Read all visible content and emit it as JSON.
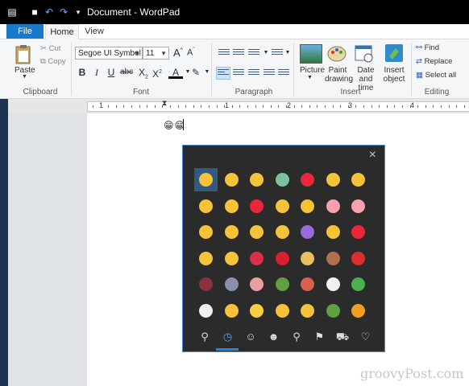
{
  "window": {
    "title": "Document - WordPad"
  },
  "tabs": {
    "file": "File",
    "home": "Home",
    "view": "View"
  },
  "clipboard": {
    "paste": "Paste",
    "cut": "Cut",
    "copy": "Copy",
    "group": "Clipboard"
  },
  "font": {
    "name": "Segoe UI Symbol",
    "size": "11",
    "group": "Font"
  },
  "paragraph": {
    "group": "Paragraph"
  },
  "insert": {
    "picture": "Picture",
    "paint_line1": "Paint",
    "paint_line2": "drawing",
    "date_line1": "Date and",
    "date_line2": "time",
    "object_line1": "Insert",
    "object_line2": "object",
    "group": "Insert"
  },
  "editing": {
    "find": "Find",
    "replace": "Replace",
    "select_all": "Select all",
    "group": "Editing"
  },
  "ruler": {
    "numbers": [
      "1",
      "1",
      "2",
      "3",
      "4"
    ]
  },
  "document": {
    "text": "😁😁"
  },
  "emoji_panel": {
    "rows": [
      [
        "#f6c23a",
        "#f6c23a",
        "#f6c23a",
        "#7cc2a0",
        "#e8273a",
        "#f6c23a",
        "#f6c23a"
      ],
      [
        "#f6c23a",
        "#f6c23a",
        "#e8273a",
        "#f6c23a",
        "#f6c23a",
        "#f6a0b0",
        "#f6a0b0"
      ],
      [
        "#f6c23a",
        "#f6c23a",
        "#f6c23a",
        "#f6c23a",
        "#9a6ad8",
        "#f6c23a",
        "#e8273a"
      ],
      [
        "#f6c23a",
        "#f6c23a",
        "#d8304a",
        "#d82030",
        "#e8c060",
        "#b07050",
        "#d83030"
      ],
      [
        "#8a3040",
        "#8a90a8",
        "#e8a0a0",
        "#60a040",
        "#d86050",
        "#f0f0f0",
        "#4cb050"
      ],
      [
        "#f0f0f0",
        "#f6c23a",
        "#f6d040",
        "#f6c23a",
        "#f6c23a",
        "#60a040",
        "#f0a020"
      ]
    ],
    "categories": [
      "search-icon",
      "recent-icon",
      "smiley-icon",
      "people-icon",
      "celebration-icon",
      "food-icon",
      "travel-icon",
      "heart-icon"
    ],
    "category_glyphs": [
      "⚲",
      "◷",
      "☺",
      "☻",
      "⚲",
      "⚑",
      "⛟",
      "♡"
    ],
    "close": "×"
  },
  "watermark": "groovyPost.com"
}
